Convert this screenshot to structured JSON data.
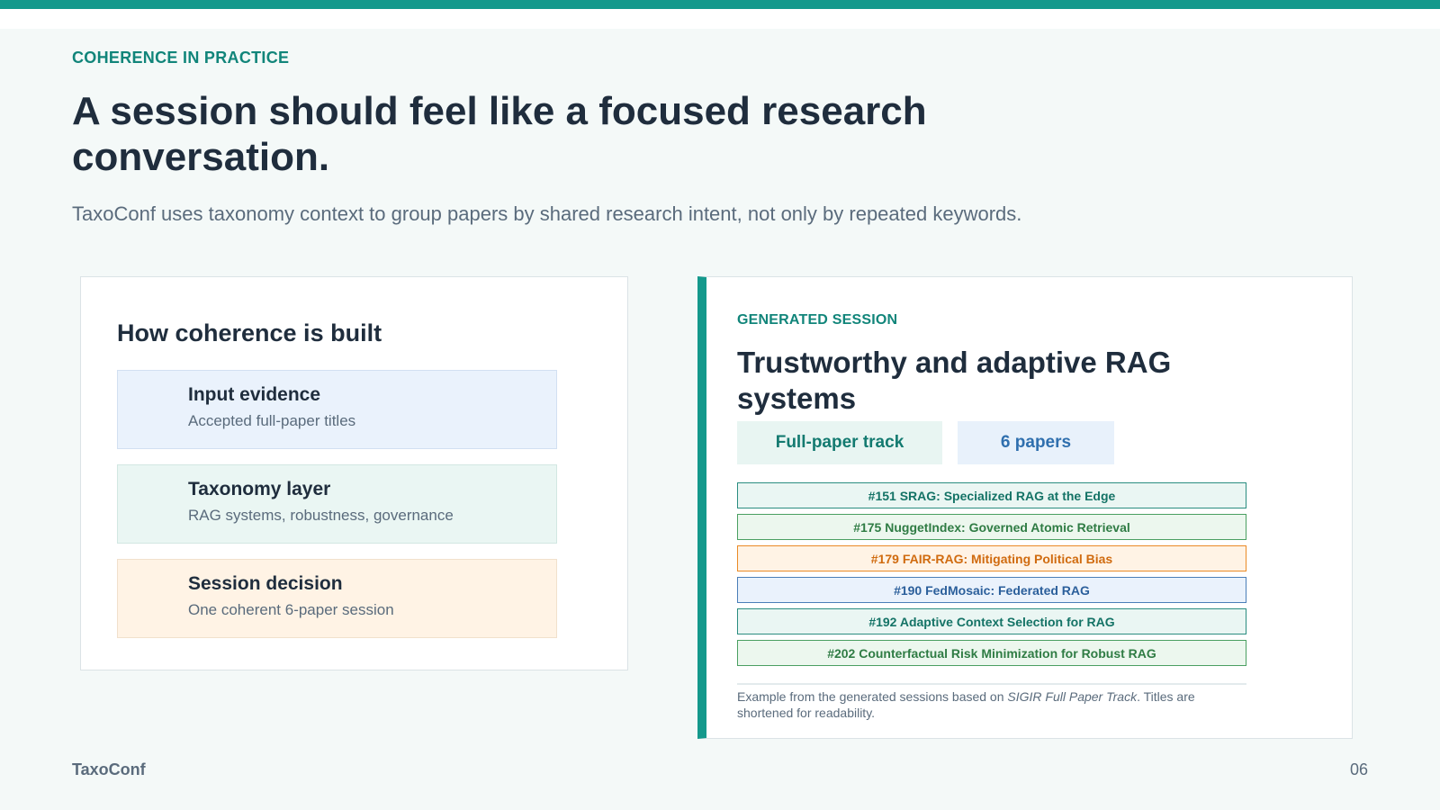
{
  "header": {
    "kicker": "COHERENCE IN PRACTICE",
    "title": "A session should feel like a focused research conversation.",
    "subtitle": "TaxoConf uses taxonomy context to group papers by shared research intent, not only by repeated keywords."
  },
  "left_panel": {
    "heading": "How coherence is built",
    "steps": [
      {
        "title": "Input evidence",
        "description": "Accepted full-paper titles"
      },
      {
        "title": "Taxonomy layer",
        "description": "RAG systems, robustness, governance"
      },
      {
        "title": "Session decision",
        "description": "One coherent 6-paper session"
      }
    ]
  },
  "right_panel": {
    "kicker": "GENERATED SESSION",
    "title": "Trustworthy and adaptive RAG systems",
    "track_badge": "Full-paper track",
    "count_badge": "6 papers",
    "papers": [
      {
        "label": "#151 SRAG: Specialized RAG at the Edge",
        "color": "#2a8d80"
      },
      {
        "label": "#175 NuggetIndex: Governed Atomic Retrieval",
        "color": "#4a9f61"
      },
      {
        "label": "#179 FAIR-RAG: Mitigating Political Bias",
        "color": "#ea8a26"
      },
      {
        "label": "#190 FedMosaic: Federated RAG",
        "color": "#4a7eb8"
      },
      {
        "label": "#192 Adaptive Context Selection for RAG",
        "color": "#2a8d80"
      },
      {
        "label": "#202 Counterfactual Risk Minimization for Robust RAG",
        "color": "#4a9f61"
      }
    ],
    "footnote_prefix": "Example from the generated sessions based on ",
    "footnote_source": "SIGIR Full Paper Track",
    "footnote_suffix": ". Titles are shortened for readability."
  },
  "footer": {
    "brand": "TaxoConf",
    "page_number": "06"
  },
  "colors": {
    "accent": "#14998c",
    "text_dark": "#1f2d3d",
    "text_muted": "#5a6b7c"
  }
}
